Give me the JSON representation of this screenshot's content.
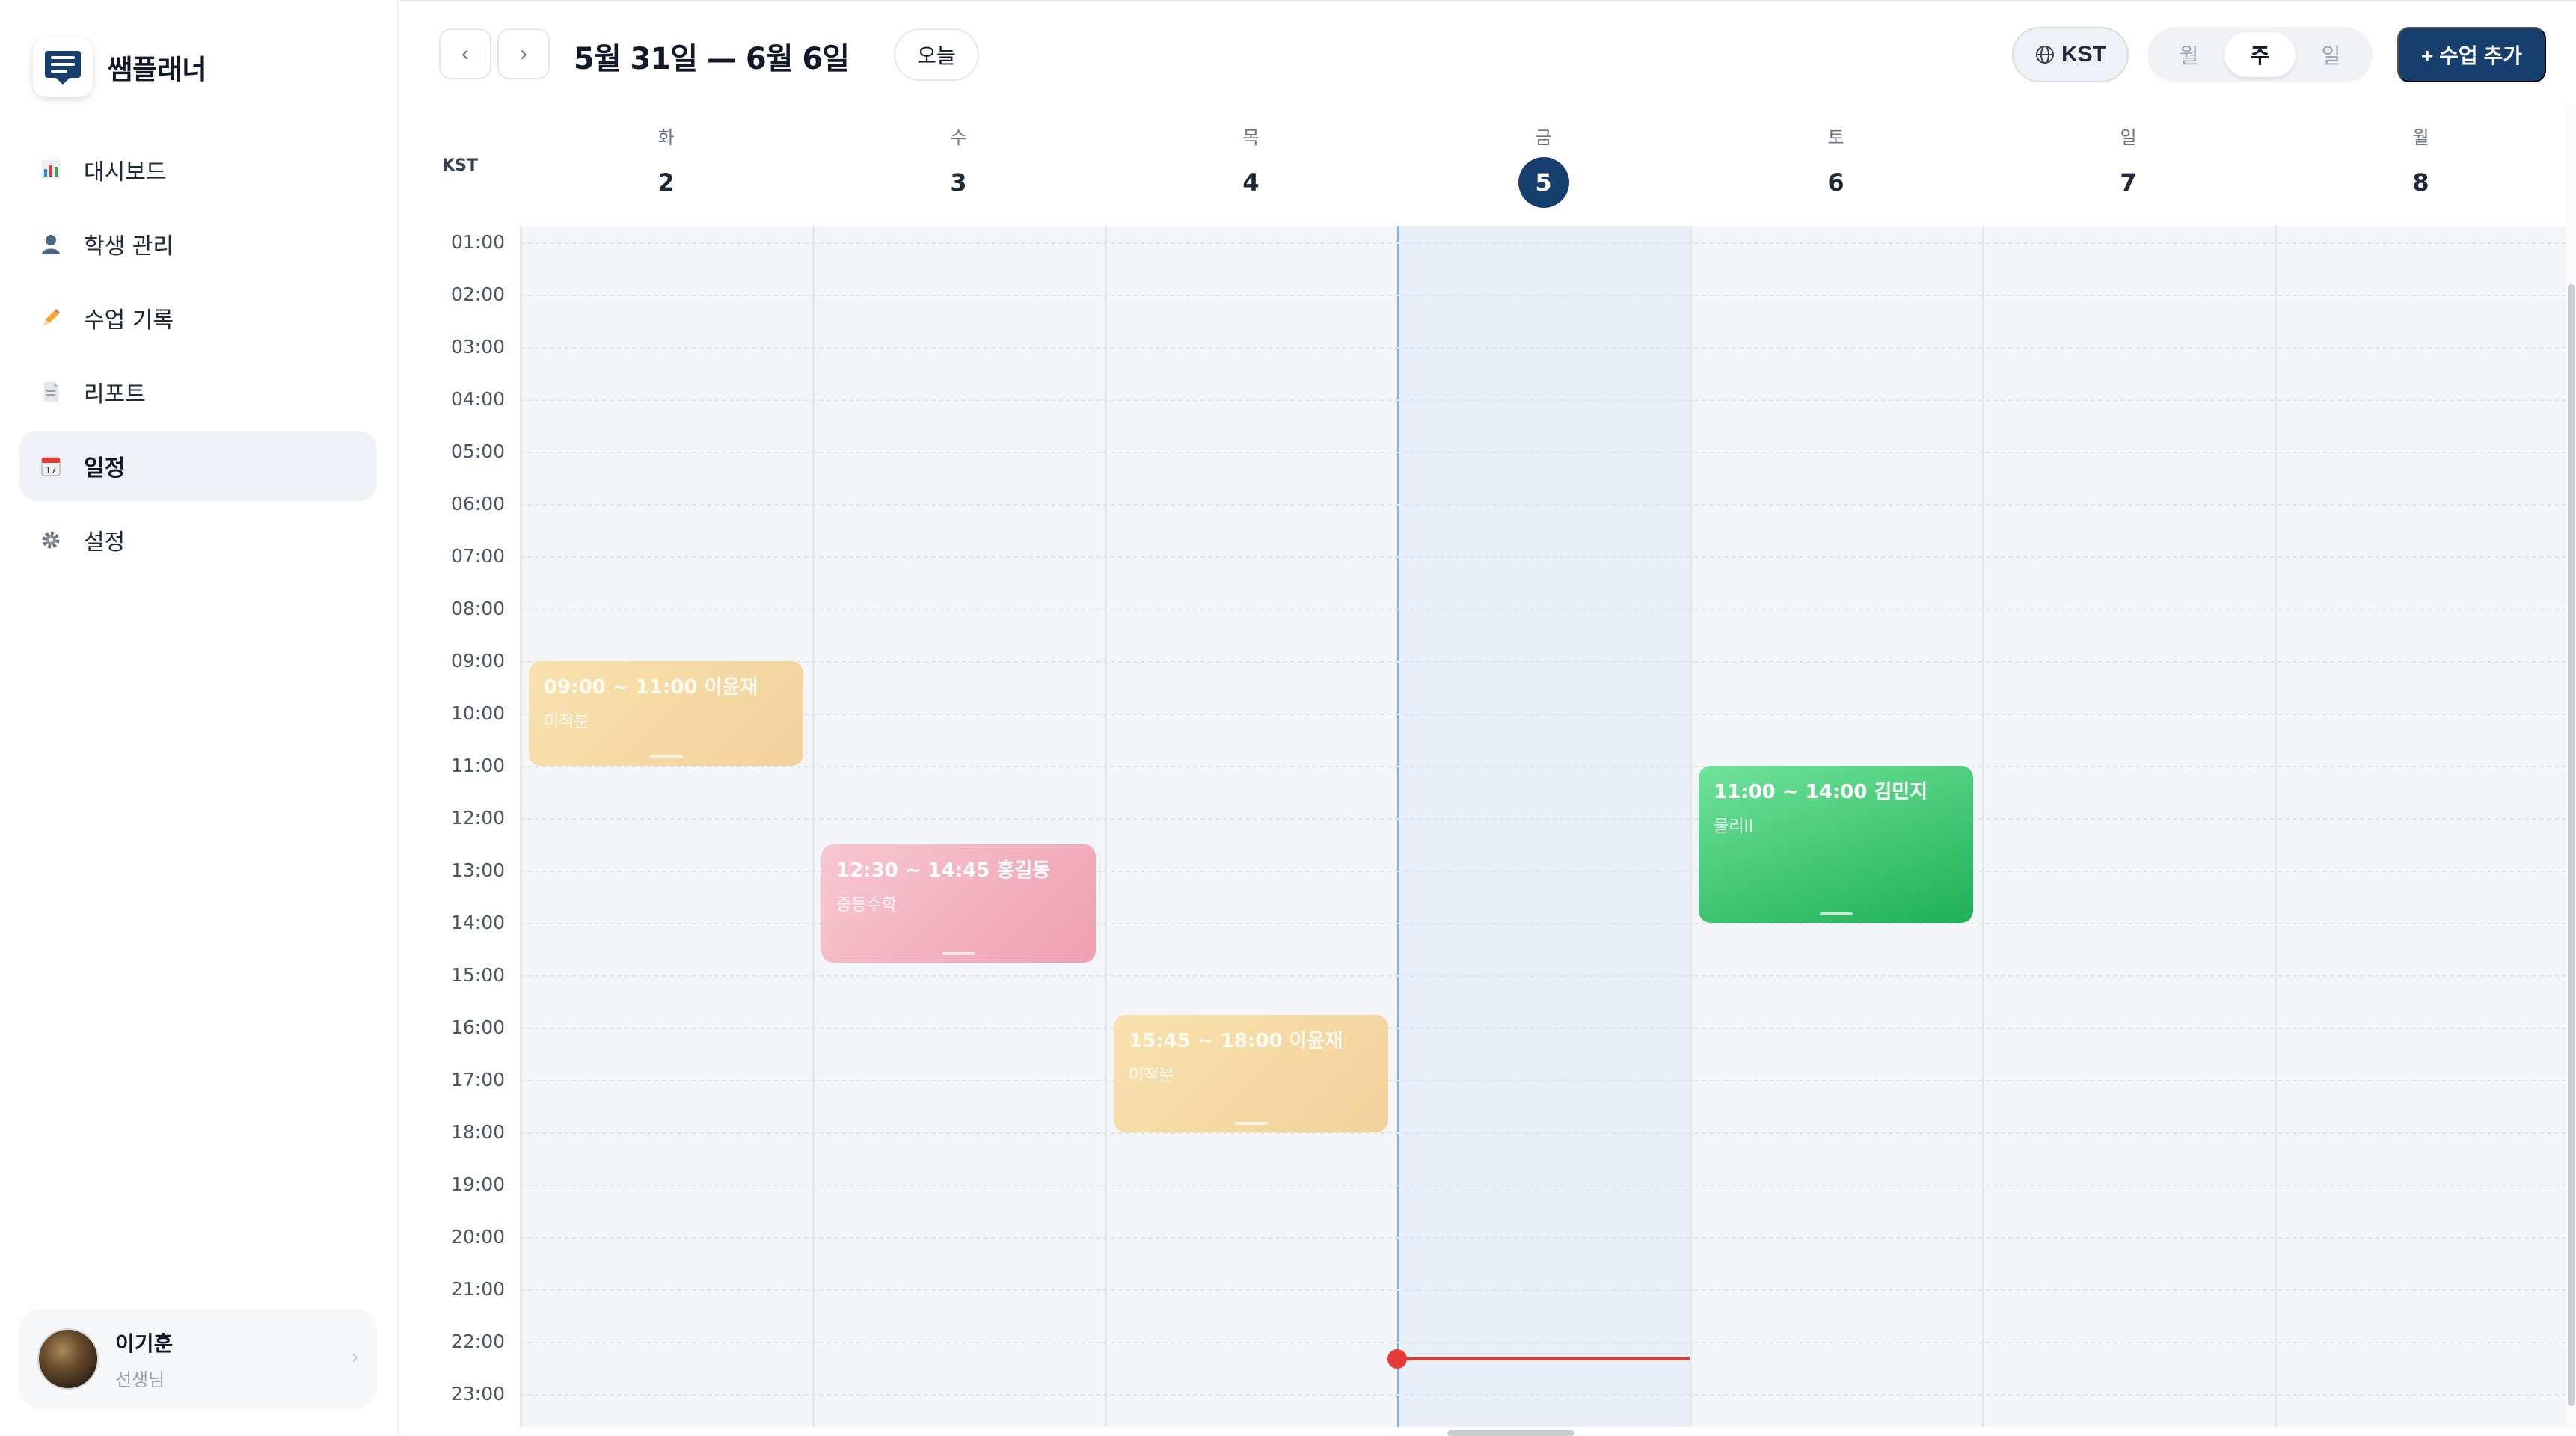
{
  "app": {
    "name": "쌤플래너"
  },
  "sidebar": {
    "items": [
      {
        "label": "대시보드",
        "icon": "bar-chart-icon",
        "active": false
      },
      {
        "label": "학생 관리",
        "icon": "person-icon",
        "active": false
      },
      {
        "label": "수업 기록",
        "icon": "pencil-icon",
        "active": false
      },
      {
        "label": "리포트",
        "icon": "document-icon",
        "active": false
      },
      {
        "label": "일정",
        "icon": "calendar-icon",
        "active": true
      },
      {
        "label": "설정",
        "icon": "gear-icon",
        "active": false
      }
    ],
    "user": {
      "name": "이기훈",
      "role": "선생님"
    }
  },
  "header": {
    "prev_label": "‹",
    "next_label": "›",
    "range_title": "5월 31일 — 6월 6일",
    "today_label": "오늘",
    "timezone_label": "KST",
    "views": [
      {
        "label": "월",
        "active": false
      },
      {
        "label": "주",
        "active": true
      },
      {
        "label": "일",
        "active": false
      }
    ],
    "add_button_label": "+ 수업 추가"
  },
  "calendar": {
    "timezone_corner": "KST",
    "days": [
      {
        "dow": "화",
        "num": "2",
        "today": false
      },
      {
        "dow": "수",
        "num": "3",
        "today": false
      },
      {
        "dow": "목",
        "num": "4",
        "today": false
      },
      {
        "dow": "금",
        "num": "5",
        "today": true
      },
      {
        "dow": "토",
        "num": "6",
        "today": false
      },
      {
        "dow": "일",
        "num": "7",
        "today": false
      },
      {
        "dow": "월",
        "num": "8",
        "today": false
      }
    ],
    "hours": [
      "01:00",
      "02:00",
      "03:00",
      "04:00",
      "05:00",
      "06:00",
      "07:00",
      "08:00",
      "09:00",
      "10:00",
      "11:00",
      "12:00",
      "13:00",
      "14:00",
      "15:00",
      "16:00",
      "17:00",
      "18:00",
      "19:00",
      "20:00",
      "21:00",
      "22:00",
      "23:00"
    ],
    "events": [
      {
        "day": 0,
        "start": "09:00",
        "end": "11:00",
        "title": "09:00 ~ 11:00 이윤재",
        "subject": "미적분",
        "color": "sand"
      },
      {
        "day": 1,
        "start": "12:30",
        "end": "14:45",
        "title": "12:30 ~ 14:45 홍길동",
        "subject": "중등수학",
        "color": "pink"
      },
      {
        "day": 2,
        "start": "15:45",
        "end": "18:00",
        "title": "15:45 ~ 18:00 이윤재",
        "subject": "미적분",
        "color": "sand"
      },
      {
        "day": 4,
        "start": "11:00",
        "end": "14:00",
        "title": "11:00 ~ 14:00 김민지",
        "subject": "물리II",
        "color": "green"
      }
    ],
    "now_time": "22:20",
    "colors": {
      "accent": "#173f6e",
      "now_indicator": "#e53935",
      "sand": "#f2d19a",
      "pink": "#ef9fb1",
      "green": "#1fb055"
    }
  }
}
